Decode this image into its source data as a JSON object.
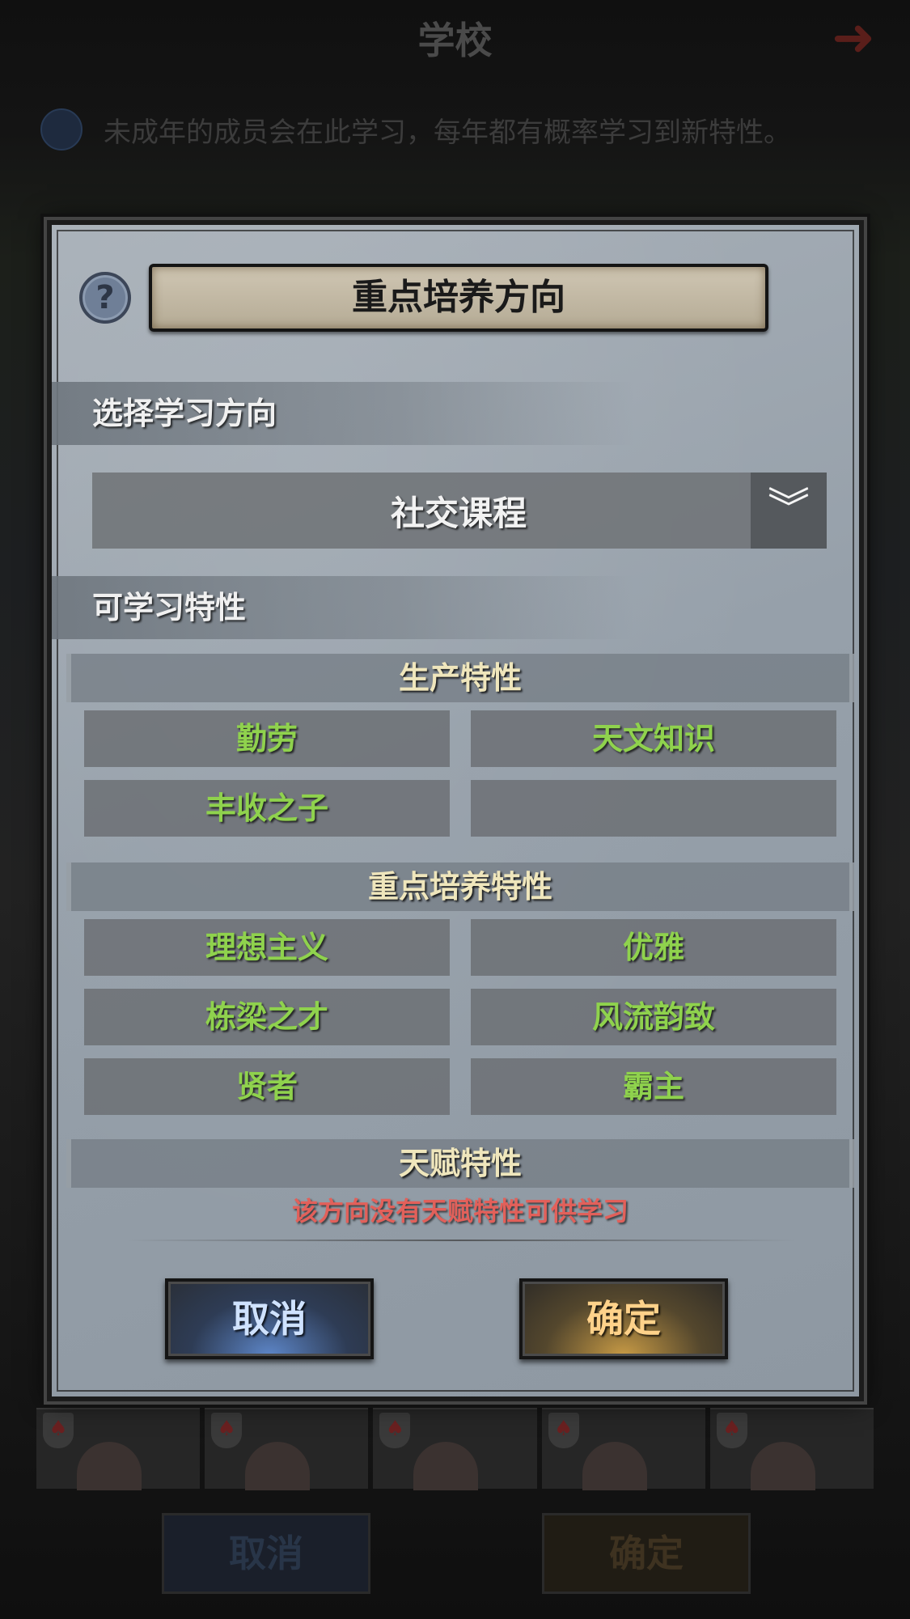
{
  "background": {
    "title": "学校",
    "info_text": "未成年的成员会在此学习，每年都有概率学习到新特性。",
    "cancel_label": "取消",
    "confirm_label": "确定"
  },
  "modal": {
    "title": "重点培养方向",
    "help_icon": "?",
    "direction_label": "选择学习方向",
    "dropdown": {
      "selected": "社交课程",
      "toggle_icon": "chevron-double-down-icon",
      "toggle_glyph": "︾"
    },
    "learnable_label": "可学习特性",
    "categories": {
      "production": {
        "title": "生产特性",
        "traits": [
          "勤劳",
          "天文知识",
          "丰收之子",
          ""
        ]
      },
      "focus": {
        "title": "重点培养特性",
        "traits": [
          "理想主义",
          "优雅",
          "栋梁之才",
          "风流韵致",
          "贤者",
          "霸主"
        ]
      },
      "talent": {
        "title": "天赋特性",
        "empty_message": "该方向没有天赋特性可供学习"
      }
    },
    "cancel_label": "取消",
    "confirm_label": "确定"
  },
  "colors": {
    "trait_text": "#8fd24d",
    "category_text": "#efe6bc",
    "warning_text": "#e2605a",
    "cancel_accent": "#5d86c8",
    "confirm_accent": "#c79a45"
  }
}
